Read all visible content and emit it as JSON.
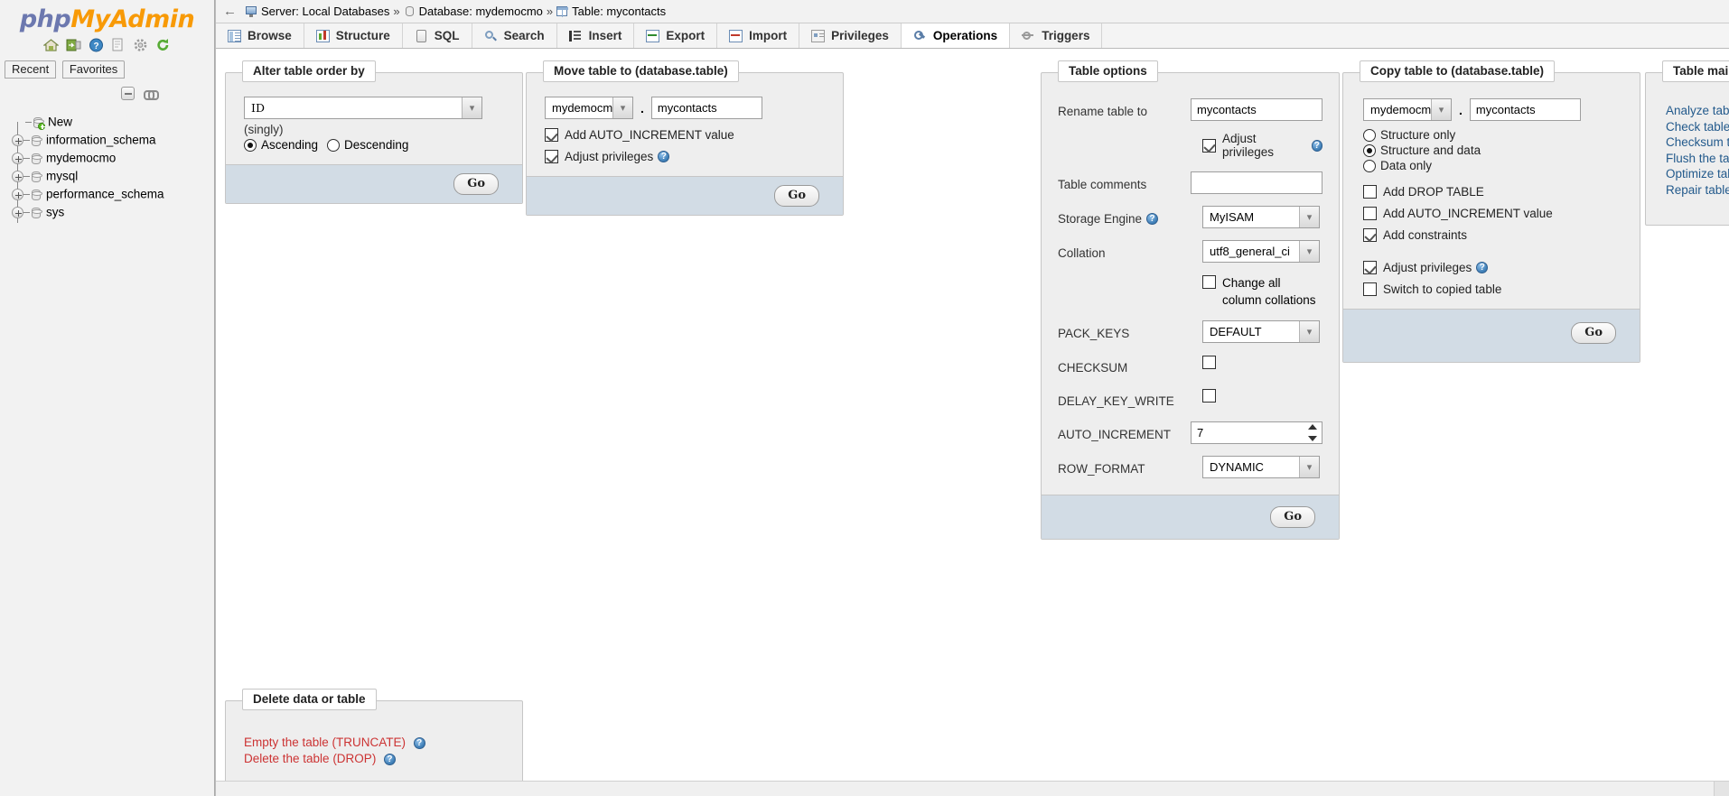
{
  "app": {
    "logo_php": "php",
    "logo_my": "My",
    "logo_admin": "Admin"
  },
  "sidebar": {
    "icons": [
      "home-icon",
      "logout-icon",
      "help-icon",
      "docs-icon",
      "settings-icon",
      "reload-icon"
    ],
    "tabs": [
      {
        "label": "Recent",
        "name": "sidebar-tab-recent"
      },
      {
        "label": "Favorites",
        "name": "sidebar-tab-favorites"
      }
    ],
    "tree": [
      {
        "label": "New",
        "expandable": false,
        "icon": "database-new-icon"
      },
      {
        "label": "information_schema",
        "expandable": true,
        "icon": "database-icon"
      },
      {
        "label": "mydemocmo",
        "expandable": true,
        "icon": "database-icon"
      },
      {
        "label": "mysql",
        "expandable": true,
        "icon": "database-icon"
      },
      {
        "label": "performance_schema",
        "expandable": true,
        "icon": "database-icon"
      },
      {
        "label": "sys",
        "expandable": true,
        "icon": "database-icon"
      }
    ]
  },
  "breadcrumb": {
    "back": "←",
    "items": [
      {
        "label": "Server: Local Databases",
        "icon": "server-icon"
      },
      {
        "label": "Database: mydemocmo",
        "icon": "database-icon"
      },
      {
        "label": "Table: mycontacts",
        "icon": "table-icon"
      }
    ],
    "separator": "»"
  },
  "tabs": [
    {
      "label": "Browse",
      "icon": "browse-icon",
      "active": false
    },
    {
      "label": "Structure",
      "icon": "structure-icon",
      "active": false
    },
    {
      "label": "SQL",
      "icon": "sql-icon",
      "active": false
    },
    {
      "label": "Search",
      "icon": "search-icon",
      "active": false
    },
    {
      "label": "Insert",
      "icon": "insert-icon",
      "active": false
    },
    {
      "label": "Export",
      "icon": "export-icon",
      "active": false
    },
    {
      "label": "Import",
      "icon": "import-icon",
      "active": false
    },
    {
      "label": "Privileges",
      "icon": "privileges-icon",
      "active": false
    },
    {
      "label": "Operations",
      "icon": "operations-icon",
      "active": true
    },
    {
      "label": "Triggers",
      "icon": "triggers-icon",
      "active": false
    }
  ],
  "alter_order": {
    "legend": "Alter table order by",
    "column_value": "ID",
    "singly_note": "(singly)",
    "ascending_label": "Ascending",
    "descending_label": "Descending",
    "ascending_checked": true,
    "descending_checked": false,
    "go_label": "Go"
  },
  "move_table": {
    "legend": "Move table to (database.table)",
    "database_value": "mydemocmo",
    "dot": ".",
    "table_value": "mycontacts",
    "add_auto_increment_label": "Add AUTO_INCREMENT value",
    "add_auto_increment_checked": true,
    "adjust_privileges_label": "Adjust privileges",
    "adjust_privileges_checked": true,
    "go_label": "Go"
  },
  "table_options": {
    "legend": "Table options",
    "rename_label": "Rename table to",
    "rename_value": "mycontacts",
    "adjust_privileges_label": "Adjust privileges",
    "adjust_privileges_checked": true,
    "comments_label": "Table comments",
    "comments_value": "",
    "storage_engine_label": "Storage Engine",
    "storage_engine_value": "MyISAM",
    "collation_label": "Collation",
    "collation_value": "utf8_general_ci",
    "change_all_collations_label": "Change all column collations",
    "change_all_collations_checked": false,
    "pack_keys_label": "PACK_KEYS",
    "pack_keys_value": "DEFAULT",
    "checksum_label": "CHECKSUM",
    "checksum_checked": false,
    "delay_key_write_label": "DELAY_KEY_WRITE",
    "delay_key_write_checked": false,
    "auto_increment_label": "AUTO_INCREMENT",
    "auto_increment_value": "7",
    "row_format_label": "ROW_FORMAT",
    "row_format_value": "DYNAMIC",
    "go_label": "Go"
  },
  "copy_table": {
    "legend": "Copy table to (database.table)",
    "database_value": "mydemocmo",
    "dot": ".",
    "table_value": "mycontacts",
    "options": [
      {
        "label": "Structure only",
        "checked": false
      },
      {
        "label": "Structure and data",
        "checked": true
      },
      {
        "label": "Data only",
        "checked": false
      }
    ],
    "add_drop_table_label": "Add DROP TABLE",
    "add_drop_table_checked": false,
    "add_auto_increment_label": "Add AUTO_INCREMENT value",
    "add_auto_increment_checked": false,
    "add_constraints_label": "Add constraints",
    "add_constraints_checked": true,
    "adjust_privileges_label": "Adjust privileges",
    "adjust_privileges_checked": true,
    "switch_to_copied_label": "Switch to copied table",
    "switch_to_copied_checked": false,
    "go_label": "Go"
  },
  "table_maintenance": {
    "legend": "Table maintenance",
    "links": [
      "Analyze table",
      "Check table",
      "Checksum table",
      "Flush the table (FLUSH)",
      "Optimize table",
      "Repair table"
    ]
  },
  "delete_panel": {
    "legend": "Delete data or table",
    "links": [
      "Empty the table (TRUNCATE)",
      "Delete the table (DROP)"
    ]
  },
  "colors": {
    "accent_orange": "#f89a07",
    "accent_purple": "#6c78af",
    "panel_bg": "#eeeeee",
    "footer_bg": "#d2dce5",
    "link_blue": "#235a8c",
    "danger_red": "#cc3333"
  }
}
